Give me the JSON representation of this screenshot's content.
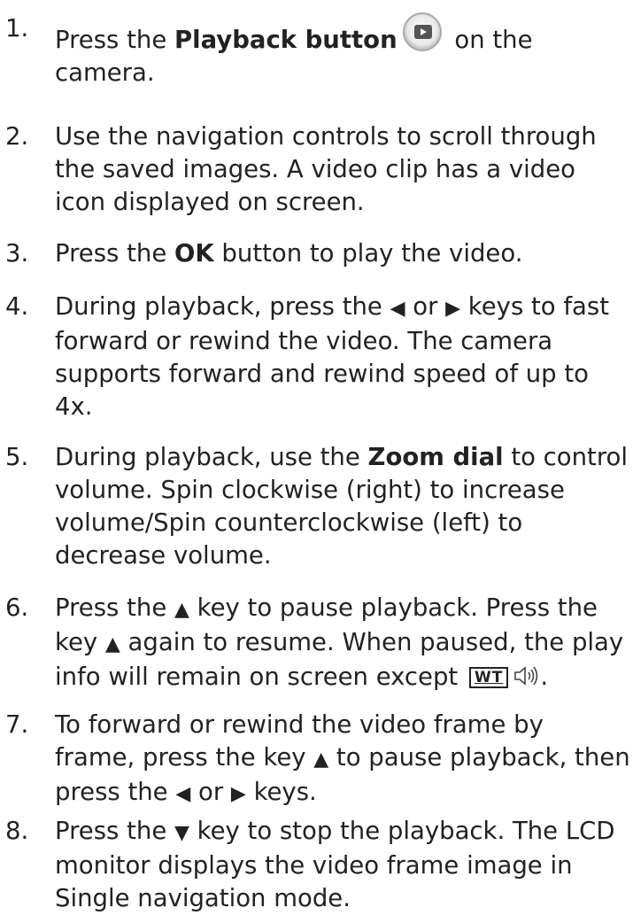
{
  "steps": [
    {
      "num": "1.",
      "a": "Press the ",
      "b": "Playback button",
      "c": " on the camera.",
      "icon": "playback-button-icon"
    },
    {
      "num": "2.",
      "text": "Use the navigation controls to scroll through the saved images. A video clip has a video icon displayed on screen."
    },
    {
      "num": "3.",
      "a": "Press the ",
      "b": "OK",
      "c": " button to play the video."
    },
    {
      "num": "4.",
      "a": "During playback, press the ",
      "left_key": "◀",
      "or": " or ",
      "right_key": "▶",
      "c": " keys to fast forward or rewind the video. The camera supports forward and rewind speed of up to 4x."
    },
    {
      "num": "5.",
      "a": "During playback, use the ",
      "b": "Zoom dial",
      "c": " to control volume. Spin clockwise (right) to increase volume/Spin counterclockwise (left) to decrease volume."
    },
    {
      "num": "6.",
      "a": "Press the ",
      "up_key": "▲",
      "c": " key to pause playback. Press the key ",
      "d": " again to resume. When paused, the play info will remain on screen except ",
      "wt": "WT",
      "end": "."
    },
    {
      "num": "7.",
      "a": "To forward or rewind the video frame by frame, press the key ",
      "up_key": "▲",
      "c": " to pause playback, then press the ",
      "left_key": "◀",
      "or": " or ",
      "right_key": "▶",
      "d": " keys."
    },
    {
      "num": "8.",
      "a": "Press the ",
      "down_key": "▼",
      "c": " key to stop the playback. The LCD monitor displays the video frame image in Single navigation mode."
    }
  ]
}
